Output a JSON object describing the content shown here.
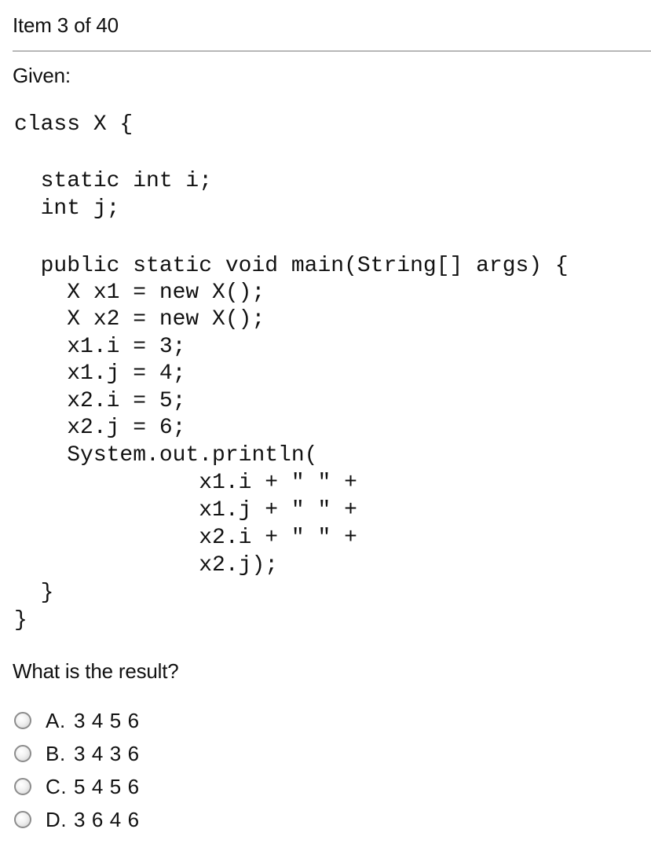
{
  "header": {
    "item_counter": "Item 3 of 40"
  },
  "question": {
    "prompt_intro": "Given:",
    "code_lines": [
      "class X {",
      "",
      "  static int i;",
      "  int j;",
      "",
      "  public static void main(String[] args) {",
      "    X x1 = new X();",
      "    X x2 = new X();",
      "    x1.i = 3;",
      "    x1.j = 4;",
      "    x2.i = 5;",
      "    x2.j = 6;",
      "    System.out.println(",
      "              x1.i + \" \" +",
      "              x1.j + \" \" +",
      "              x2.i + \" \" +",
      "              x2.j);",
      "  }",
      "}"
    ],
    "prompt": "What is the result?"
  },
  "choices": [
    {
      "letter": "A.",
      "text": "3 4 5 6"
    },
    {
      "letter": "B.",
      "text": "3 4 3 6"
    },
    {
      "letter": "C.",
      "text": "5 4 5 6"
    },
    {
      "letter": "D.",
      "text": "3 6 4 6"
    }
  ]
}
